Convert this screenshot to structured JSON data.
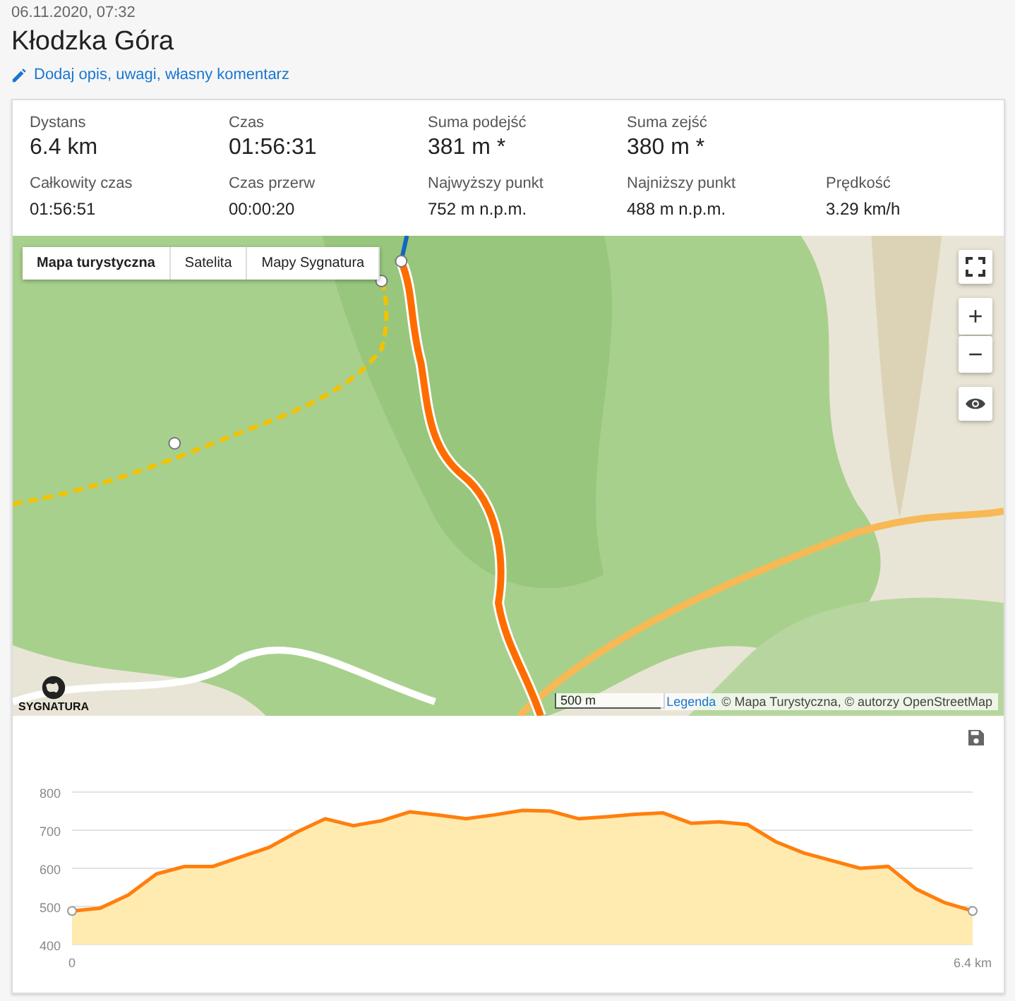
{
  "header": {
    "date": "06.11.2020, 07:32",
    "title": "Kłodzka Góra",
    "edit_link": "Dodaj opis, uwagi, własny komentarz"
  },
  "stat_rows": [
    {
      "kind": "main",
      "items": [
        {
          "label": "Dystans",
          "value": "6.4 km"
        },
        {
          "label": "Czas",
          "value": "01:56:31"
        },
        {
          "label": "Suma podejść",
          "value": "381 m *"
        },
        {
          "label": "Suma zejść",
          "value": "380 m *"
        }
      ]
    },
    {
      "kind": "detail",
      "items": [
        {
          "label": "Całkowity czas",
          "value": "01:56:51"
        },
        {
          "label": "Czas przerw",
          "value": "00:00:20"
        },
        {
          "label": "Najwyższy punkt",
          "value": "752 m n.p.m."
        },
        {
          "label": "Najniższy punkt",
          "value": "488 m n.p.m."
        },
        {
          "label": "Prędkość",
          "value": "3.29 km/h"
        }
      ]
    }
  ],
  "map": {
    "layers": [
      {
        "label": "Mapa turystyczna",
        "selected": true
      },
      {
        "label": "Satelita",
        "selected": false
      },
      {
        "label": "Mapy Sygnatura",
        "selected": false
      }
    ],
    "zoom_in": "+",
    "zoom_out": "−",
    "logo": "SYGNATURA",
    "scale": "500 m",
    "legend_link": "Legenda",
    "attribution": "© Mapa Turystyczna, © autorzy OpenStreetMap"
  },
  "elevation": {
    "chart_data": {
      "type": "area",
      "x": [
        0,
        0.2,
        0.4,
        0.6,
        0.8,
        1.0,
        1.2,
        1.4,
        1.6,
        1.8,
        2.0,
        2.2,
        2.4,
        2.6,
        2.8,
        3.0,
        3.2,
        3.4,
        3.6,
        3.8,
        4.0,
        4.2,
        4.4,
        4.6,
        4.8,
        5.0,
        5.2,
        5.4,
        5.6,
        5.8,
        6.0,
        6.2,
        6.4
      ],
      "series": [
        {
          "color": "#ff7f0e",
          "values": [
            488,
            495,
            530,
            585,
            605,
            605,
            630,
            655,
            695,
            730,
            712,
            725,
            748,
            740,
            730,
            740,
            752,
            750,
            730,
            735,
            742,
            745,
            718,
            722,
            715,
            670,
            640,
            620,
            600,
            605,
            545,
            510,
            488
          ]
        }
      ],
      "grid": true,
      "xlim": [
        0,
        6.4
      ],
      "ylim": [
        400,
        800
      ],
      "yticks": [
        400,
        500,
        600,
        700,
        800
      ],
      "xticks": [
        0,
        {
          "value": 6.4,
          "label": "6.4 km"
        }
      ]
    }
  }
}
